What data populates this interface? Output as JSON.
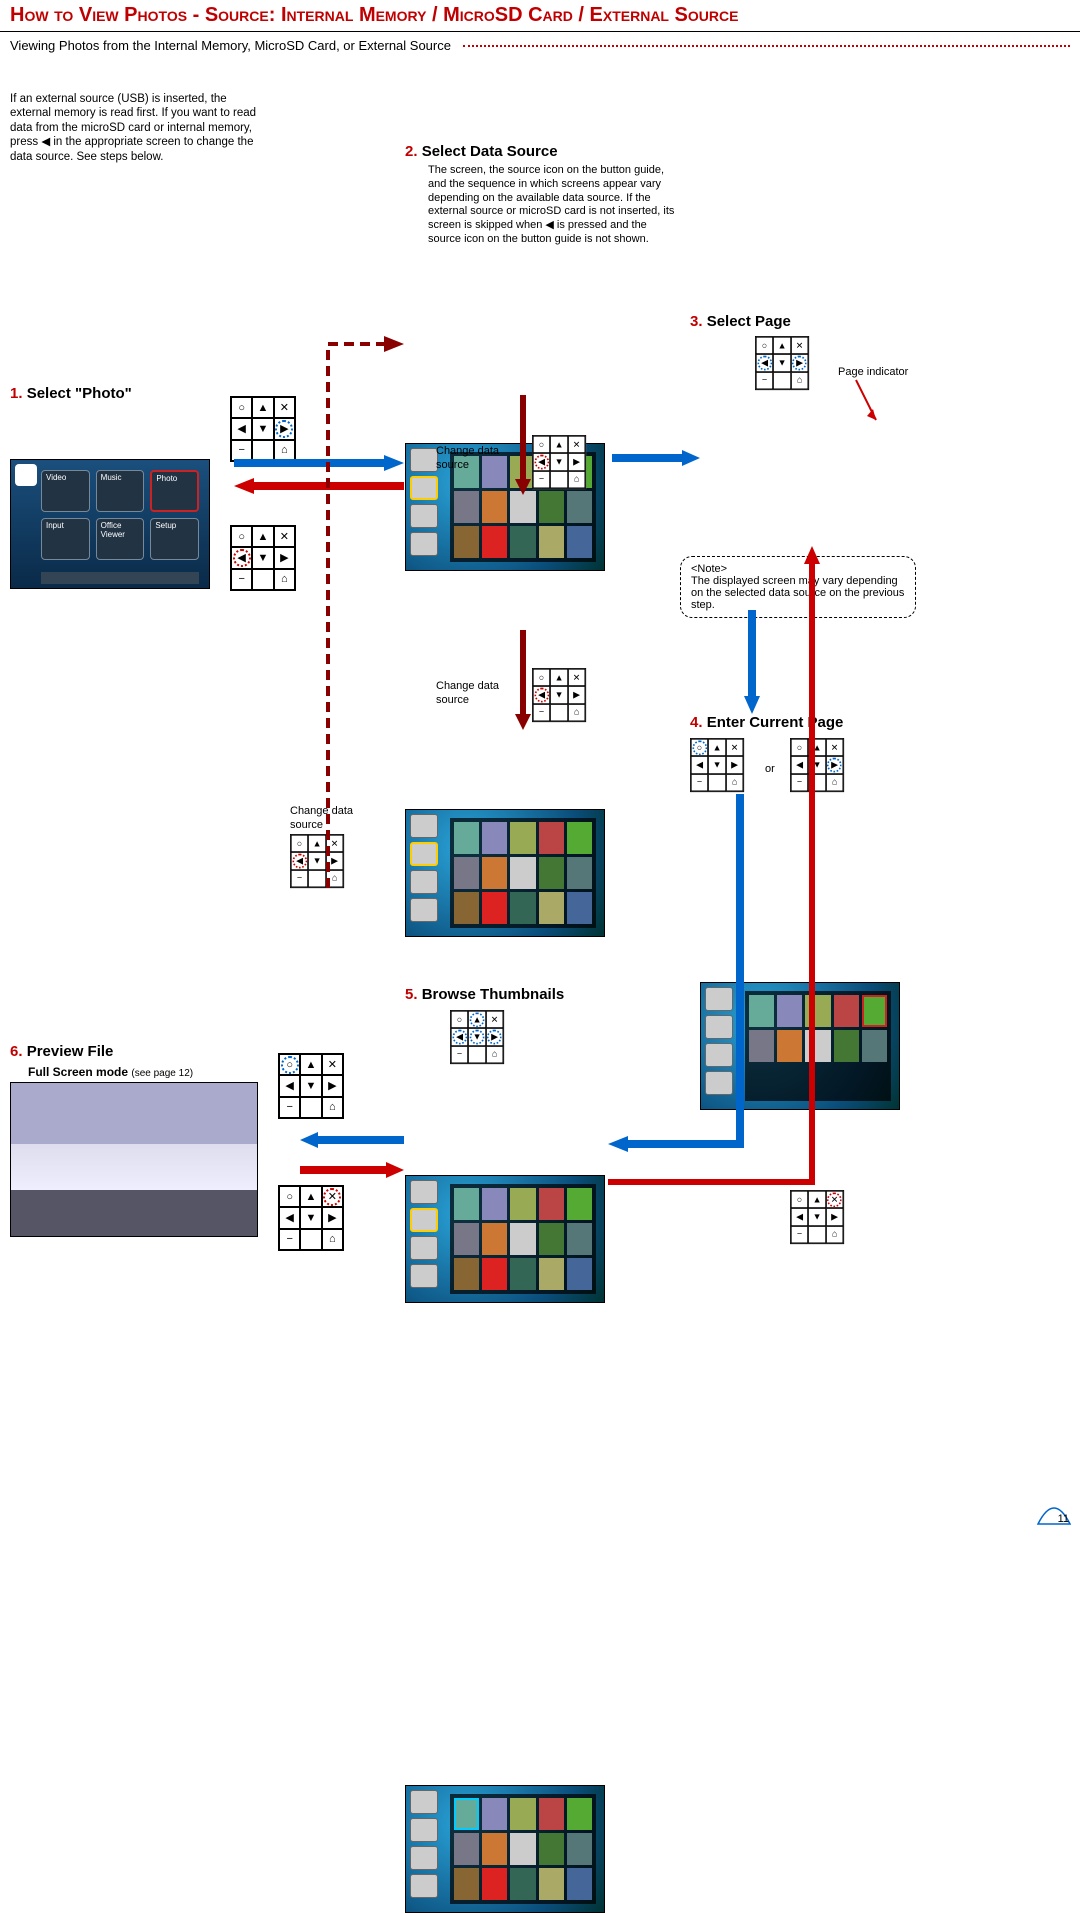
{
  "title": "How to View Photos - Source: Internal Memory / MicroSD Card / External Source",
  "subtitle": "Viewing Photos from the Internal Memory, MicroSD Card, or External Source",
  "intro": "If an external source (USB) is inserted, the external memory is read first. If you want to read data from the microSD card or internal memory, press ◀ in the appropriate screen to change the data source. See steps below.",
  "steps": {
    "s1": {
      "num": "1.",
      "title": "Select \"Photo\""
    },
    "s2": {
      "num": "2.",
      "title": "Select Data Source",
      "body": "The screen, the source icon on the button guide, and the sequence in which screens appear vary depending on the available data source. If the external source or microSD card is not inserted, its screen is skipped when ◀ is pressed and the source icon on the button guide is not shown."
    },
    "s3": {
      "num": "3.",
      "title": "Select Page",
      "page_ind": "Page indicator"
    },
    "s4": {
      "num": "4.",
      "title": "Enter Current Page",
      "or": "or"
    },
    "s5": {
      "num": "5.",
      "title": "Browse Thumbnails"
    },
    "s6": {
      "num": "6.",
      "title": "Preview File",
      "sub": "Full Screen mode",
      "subref": "(see page 12)"
    }
  },
  "change_src": "Change data source",
  "note": {
    "hd": "<Note>",
    "body": "The displayed screen may vary depending on the selected data source on the previous step."
  },
  "remote_glyphs": {
    "circle": "○",
    "up": "▲",
    "x": "✕",
    "left": "◀",
    "down": "▼",
    "right": "▶",
    "minus": "−",
    "home": "⌂"
  },
  "menu_labels": [
    "Video",
    "Music",
    "Photo",
    "Input",
    "Office Viewer",
    "Setup"
  ],
  "page_number": "11"
}
